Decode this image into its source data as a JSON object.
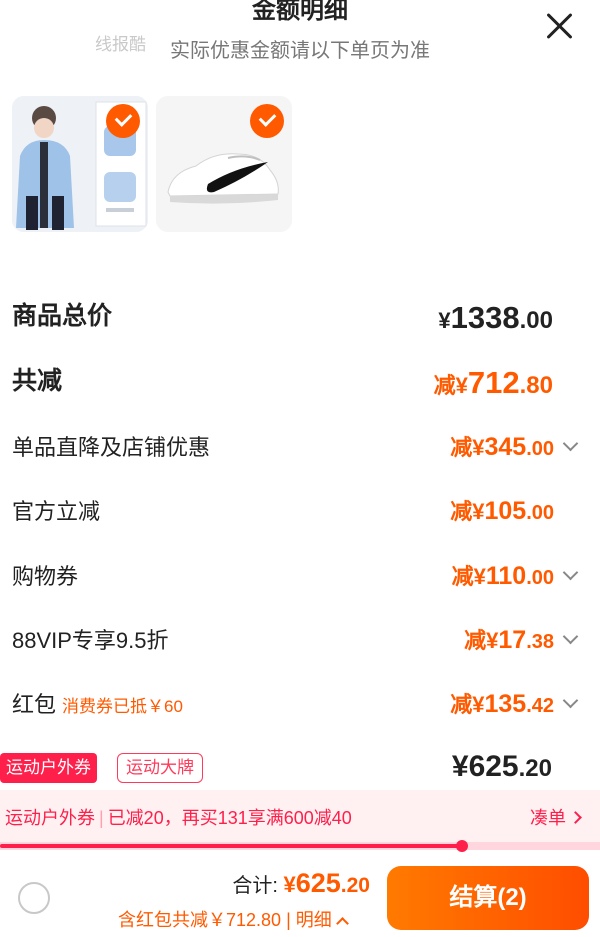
{
  "header": {
    "title": "金额明细",
    "watermark": "线报酷",
    "subtitle": "实际优惠金额请以下单页为准"
  },
  "products": [
    {
      "name": "蓝色外套",
      "icon": "jacket-image",
      "selected": true
    },
    {
      "name": "白色运动鞋",
      "icon": "sneaker-image",
      "selected": true
    }
  ],
  "breakdown": {
    "total": {
      "label": "商品总价",
      "currency": "¥",
      "int": "1338",
      "dec": ".00"
    },
    "reduced": {
      "label": "共减",
      "prefix": "减¥",
      "int": "712",
      "dec": ".80"
    },
    "items": [
      {
        "label": "单品直降及店铺优惠",
        "note": "",
        "prefix": "减¥",
        "int": "345",
        "dec": ".00",
        "expandable": true
      },
      {
        "label": "官方立减",
        "note": "",
        "prefix": "减¥",
        "int": "105",
        "dec": ".00",
        "expandable": false
      },
      {
        "label": "购物券",
        "note": "",
        "prefix": "减¥",
        "int": "110",
        "dec": ".00",
        "expandable": true
      },
      {
        "label": "88VIP专享9.5折",
        "note": "",
        "prefix": "减¥",
        "int": "17",
        "dec": ".38",
        "expandable": true
      },
      {
        "label": "红包",
        "note": "消费券已抵￥60",
        "prefix": "减¥",
        "int": "135",
        "dec": ".42",
        "expandable": true
      }
    ]
  },
  "promo": {
    "tag_red": "运动户外券",
    "tag_outline": "运动大牌",
    "final_currency": "¥",
    "final_int": "625",
    "final_dec": ".20",
    "bar_tag": "运动户外券",
    "bar_sep": "|",
    "bar_text": "已减20，再买131享满600减40",
    "bar_link": "凑单",
    "progress": 0.77
  },
  "footer": {
    "sum_label": "合计: ",
    "sum_currency": "¥",
    "sum_int": "625",
    "sum_dec": ".20",
    "sub_text": "含红包共减￥712.80",
    "sub_sep": " | ",
    "sub_link": "明细",
    "checkout_label": "结算(2)"
  },
  "colors": {
    "accent": "#ff5a00",
    "promo_red": "#ff1f4b"
  }
}
